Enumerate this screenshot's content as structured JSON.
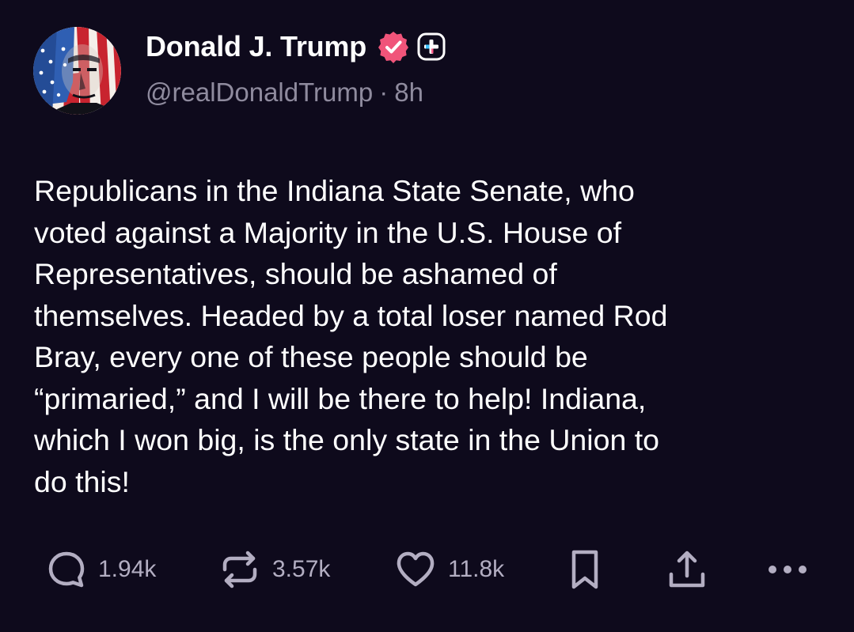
{
  "author": {
    "display_name": "Donald J. Trump",
    "handle": "@realDonaldTrump",
    "separator": "·",
    "time_ago": "8h",
    "verified_badge_color": "#f0547a"
  },
  "post": {
    "text": "Republicans in the Indiana State Senate, who\nvoted against a Majority in the U.S. House of\nRepresentatives, should be ashamed of\nthemselves. Headed by a total loser named Rod\nBray, every one of these people should be\n“primaried,” and I will be there to help! Indiana,\nwhich I won big, is the only state in the Union to\ndo this!"
  },
  "actions": {
    "replies": "1.94k",
    "reposts": "3.57k",
    "likes": "11.8k"
  },
  "icons": {
    "reply": "speech-bubble-icon",
    "repost": "repost-arrows-icon",
    "like": "heart-icon",
    "bookmark": "bookmark-icon",
    "share": "share-upload-icon",
    "more": "more-dots-icon"
  },
  "colors": {
    "background": "#0e0a1c",
    "text": "#ffffff",
    "muted": "#8f8b9e",
    "action_gray": "#b3aec2"
  }
}
